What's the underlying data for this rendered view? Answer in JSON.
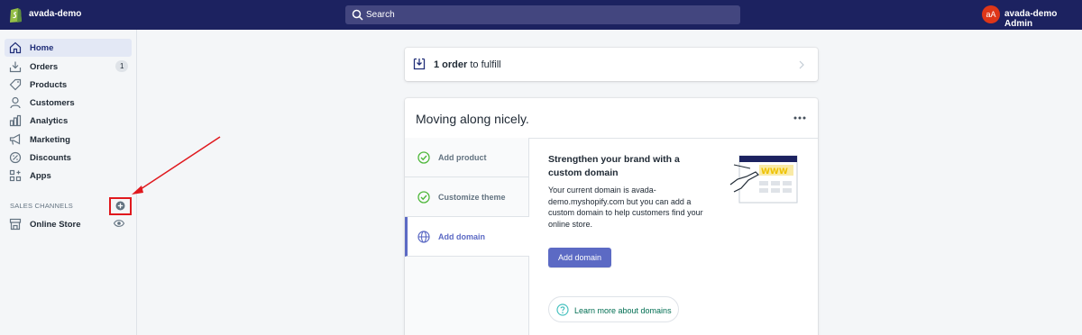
{
  "topbar": {
    "store_name": "avada-demo",
    "search_placeholder": "Search",
    "avatar_initials": "aA",
    "user_name": "avada-demo Admin"
  },
  "sidebar": {
    "items": [
      {
        "label": "Home",
        "icon": "home-icon",
        "active": true
      },
      {
        "label": "Orders",
        "icon": "orders-icon",
        "badge": "1"
      },
      {
        "label": "Products",
        "icon": "tag-icon"
      },
      {
        "label": "Customers",
        "icon": "person-icon"
      },
      {
        "label": "Analytics",
        "icon": "bar-chart-icon"
      },
      {
        "label": "Marketing",
        "icon": "megaphone-icon"
      },
      {
        "label": "Discounts",
        "icon": "discount-icon"
      },
      {
        "label": "Apps",
        "icon": "apps-icon"
      }
    ],
    "sales_channels_title": "SALES CHANNELS",
    "channels": [
      {
        "label": "Online Store",
        "icon": "store-icon"
      }
    ]
  },
  "fulfill": {
    "count_text": "1 order",
    "rest_text": " to fulfill"
  },
  "setup": {
    "title": "Moving along nicely.",
    "steps": [
      {
        "label": "Add product",
        "done": true
      },
      {
        "label": "Customize theme",
        "done": true
      },
      {
        "label": "Add domain",
        "done": false,
        "active": true
      }
    ],
    "panel": {
      "title": "Strengthen your brand with a custom domain",
      "body": "Your current domain is avada-demo.myshopify.com but you can add a custom domain to help customers find your online store.",
      "primary_button": "Add domain",
      "learn_more": "Learn more about domains",
      "illustration_text": "WWW"
    }
  },
  "colors": {
    "topbar": "#1c2260",
    "accent": "#5c6ac4",
    "highlight_box": "#e0191e",
    "check_green": "#50b83c"
  }
}
